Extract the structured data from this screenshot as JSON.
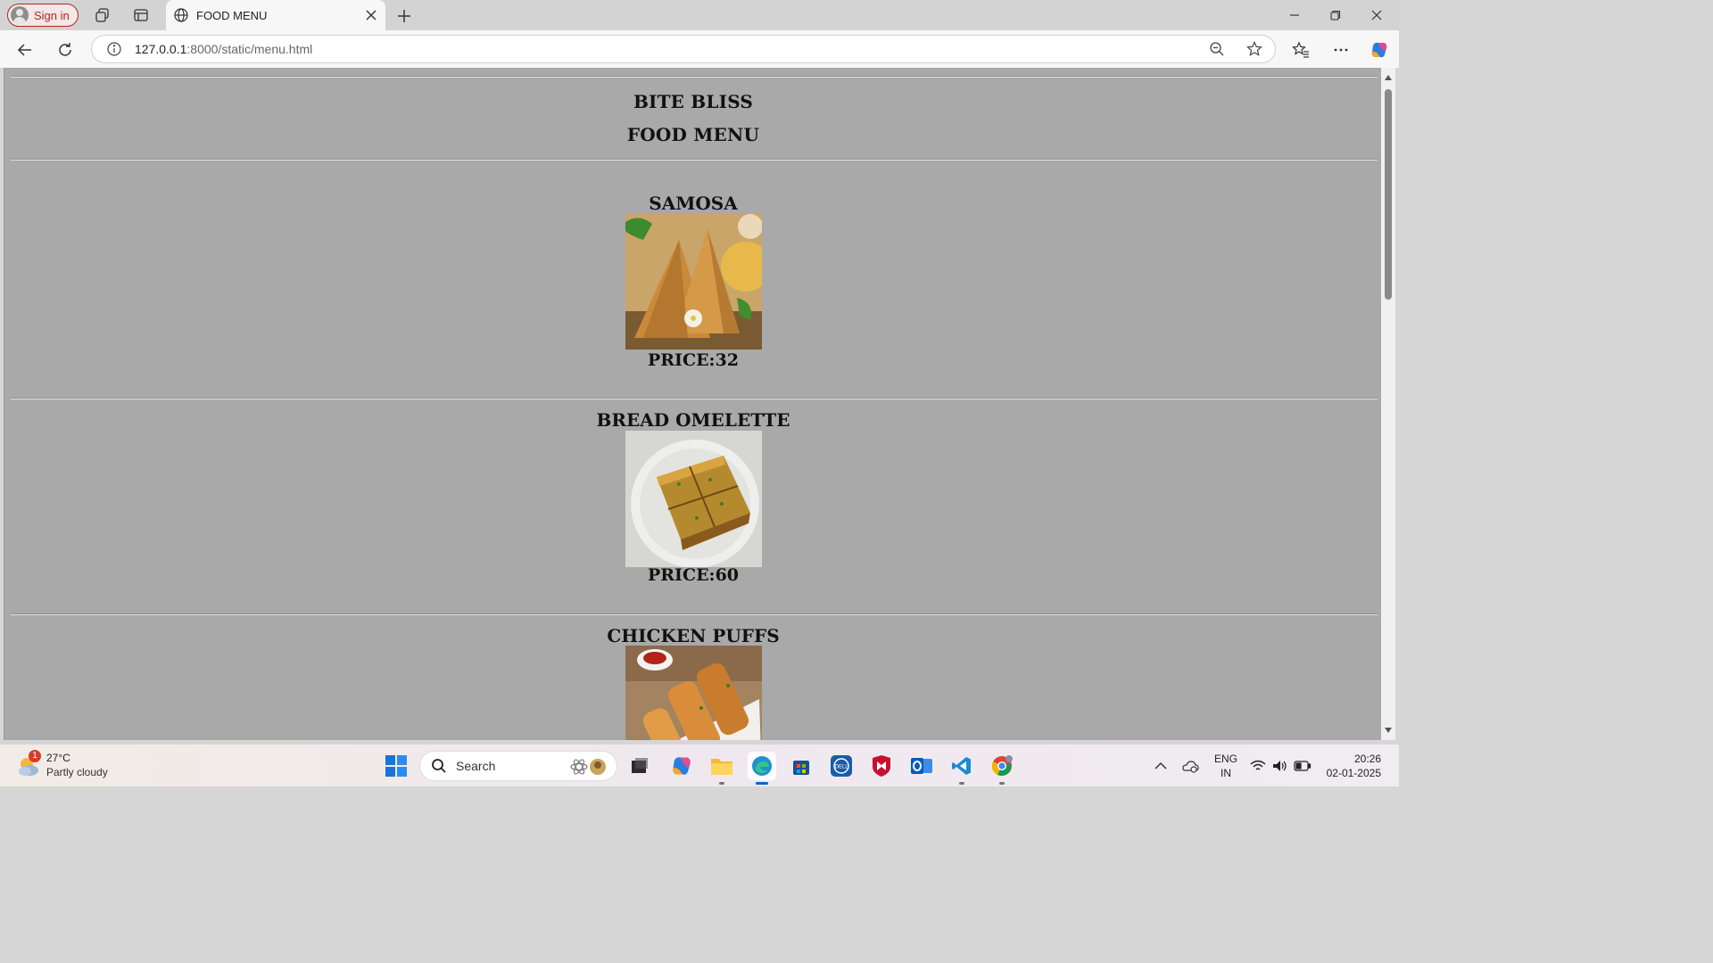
{
  "browser": {
    "sign_in_label": "Sign in",
    "tab_title": "FOOD MENU",
    "url_host": "127.0.0.1",
    "url_rest": ":8000/static/menu.html"
  },
  "page": {
    "restaurant_name": "BITE BLISS",
    "menu_title": "FOOD MENU",
    "items": [
      {
        "name": "SAMOSA",
        "price": "PRICE:32"
      },
      {
        "name": "BREAD OMELETTE",
        "price": "PRICE:60"
      },
      {
        "name": "CHICKEN PUFFS"
      }
    ]
  },
  "taskbar": {
    "weather_badge": "1",
    "temperature": "27°C",
    "condition": "Partly cloudy",
    "search_label": "Search",
    "lang_line1": "ENG",
    "lang_line2": "IN",
    "time": "20:26",
    "date": "02-01-2025"
  },
  "colors": {
    "page_background": "#a9a9a9",
    "accent": "#0067c0",
    "signin_red": "#b3261e"
  }
}
